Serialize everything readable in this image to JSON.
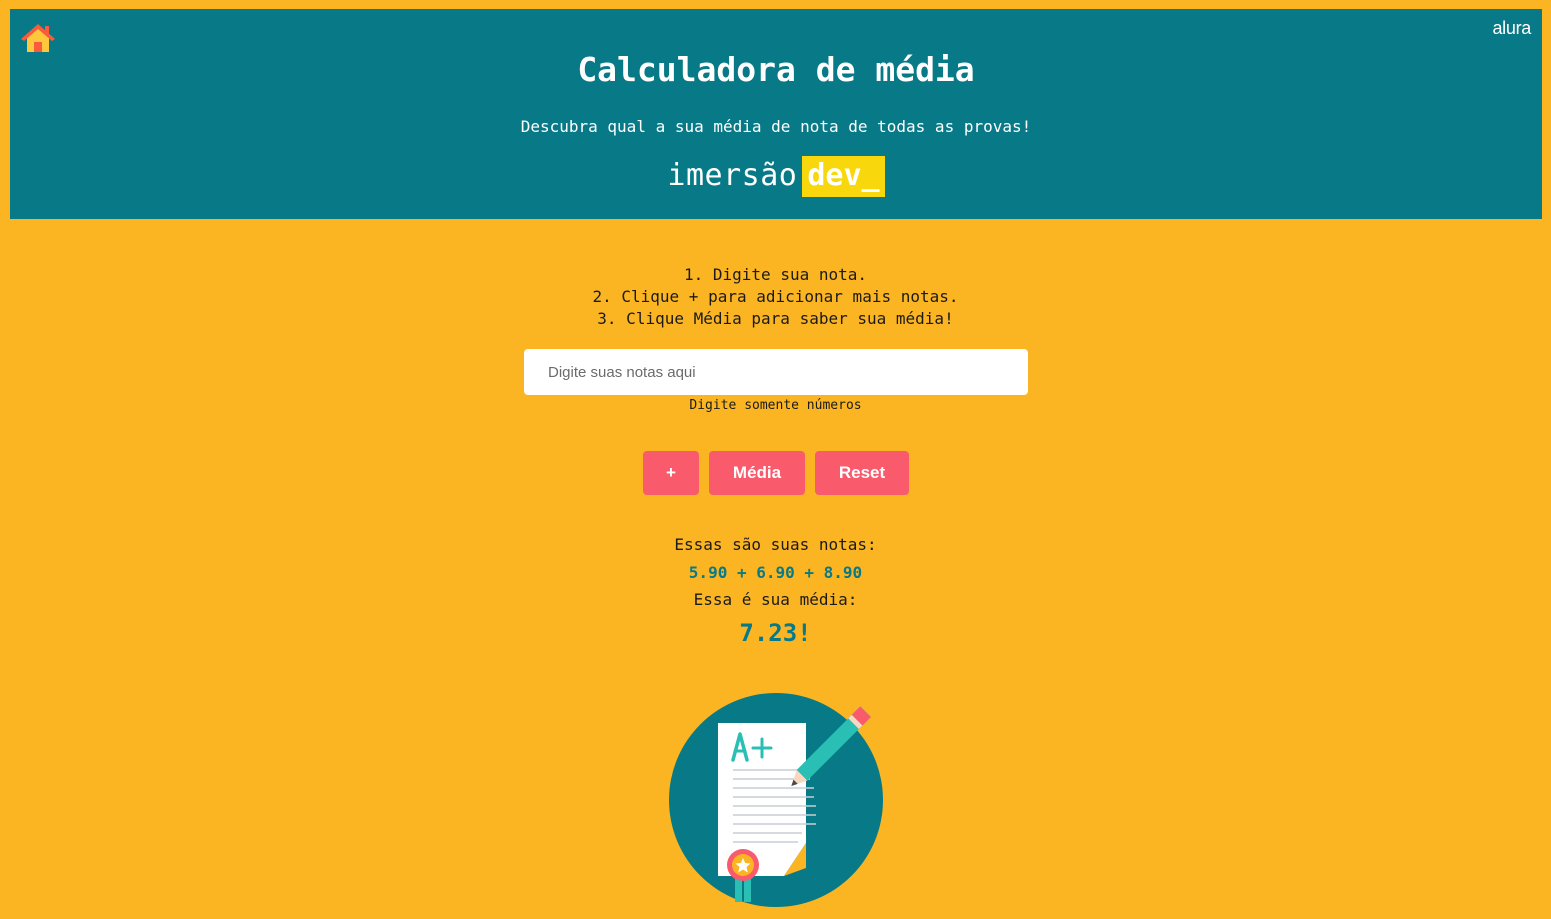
{
  "header": {
    "home_icon": "home-icon",
    "brand": "alura",
    "title": "Calculadora de média",
    "subtitle": "Descubra qual a sua média de nota de todas as provas!",
    "logo": {
      "text": "imersão",
      "highlight": "dev_"
    }
  },
  "instructions": [
    "1. Digite sua nota.",
    "2. Clique + para adicionar mais notas.",
    "3. Clique Média para saber sua média!"
  ],
  "input": {
    "value": "",
    "placeholder": "Digite suas notas aqui"
  },
  "hint": "Digite somente números",
  "buttons": {
    "add": "+",
    "average": "Média",
    "reset": "Reset"
  },
  "results": {
    "notes_label": "Essas são suas notas:",
    "notes_values": "5.90 + 6.90 + 8.90",
    "average_label": "Essa é sua média:",
    "average_value": "7.23!"
  },
  "illustration": {
    "icon": "graded-exam-illustration",
    "grade_text": "A+"
  },
  "colors": {
    "background": "#FBB523",
    "header": "#087A87",
    "button": "#F95B6C",
    "accent_text": "#087A87",
    "logo_highlight": "#F8D80D"
  }
}
